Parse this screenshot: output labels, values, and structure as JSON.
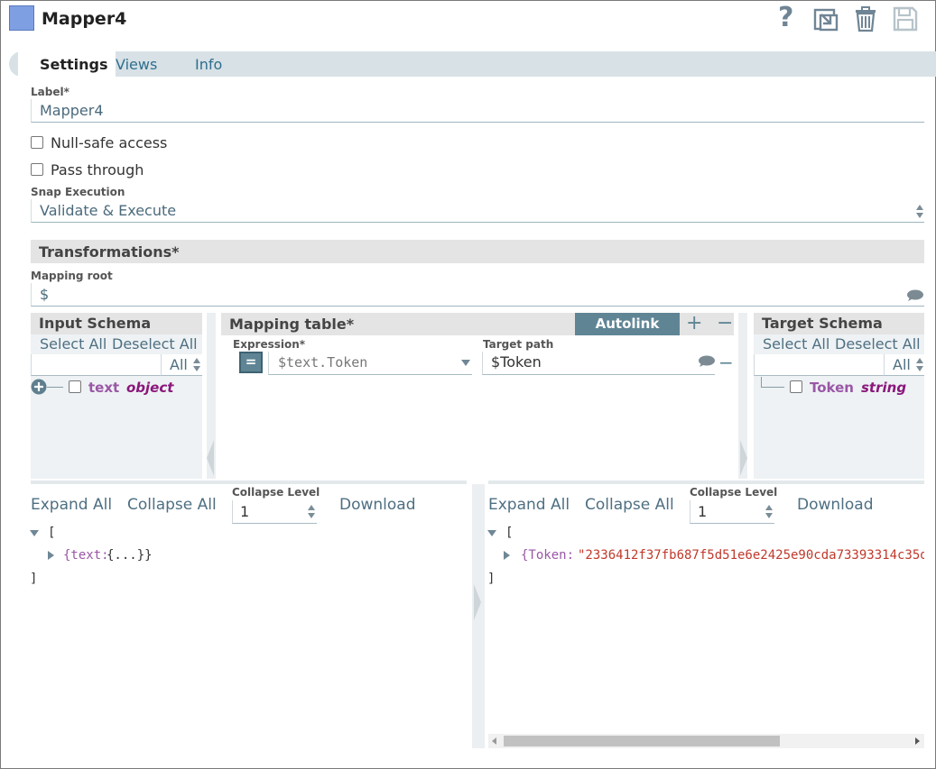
{
  "header": {
    "title": "Mapper4",
    "help_glyph": "?",
    "icons": [
      "help-icon",
      "export-icon",
      "trash-icon",
      "save-icon"
    ]
  },
  "tabs": [
    {
      "label": "Settings",
      "active": true
    },
    {
      "label": "Views",
      "active": false
    },
    {
      "label": "Info",
      "active": false
    }
  ],
  "settings": {
    "label_field": {
      "label": "Label*",
      "value": "Mapper4"
    },
    "null_safe": {
      "label": "Null-safe access",
      "checked": false
    },
    "pass_through": {
      "label": "Pass through",
      "checked": false
    },
    "snap_execution": {
      "label": "Snap Execution",
      "value": "Validate & Execute"
    }
  },
  "transformations": {
    "title": "Transformations*",
    "mapping_root": {
      "label": "Mapping root",
      "value": "$"
    }
  },
  "input_schema": {
    "title": "Input Schema",
    "select_all": "Select All",
    "deselect_all": "Deselect All",
    "filter_option": "All",
    "items": [
      {
        "name": "text",
        "type": "object"
      }
    ]
  },
  "mapping_table": {
    "title": "Mapping table*",
    "autolink": "Autolink",
    "add_glyph": "+",
    "remove_glyph": "−",
    "expression_label": "Expression*",
    "target_label": "Target path",
    "eq_glyph": "=",
    "rows": [
      {
        "expression": "$text.Token",
        "target": "$Token"
      }
    ]
  },
  "target_schema": {
    "title": "Target Schema",
    "select_all": "Select All",
    "deselect_all": "Deselect All",
    "filter_option": "All",
    "items": [
      {
        "name": "Token",
        "type": "string"
      }
    ]
  },
  "preview_left": {
    "expand_all": "Expand All",
    "collapse_all": "Collapse All",
    "collapse_level_label": "Collapse Level",
    "collapse_level": "1",
    "download": "Download",
    "open_bracket": "[",
    "close_bracket": "]",
    "row_key": "{text:",
    "row_value": "{...}}"
  },
  "preview_right": {
    "expand_all": "Expand All",
    "collapse_all": "Collapse All",
    "collapse_level_label": "Collapse Level",
    "collapse_level": "1",
    "download": "Download",
    "open_bracket": "[",
    "close_bracket": "]",
    "row_key": "{Token:",
    "row_value": "\"2336412f37fb687f5d51e6e2425e90cda73393314c35d",
    "scroll_fraction": 0.39
  },
  "colors": {
    "accent": "#5f8595",
    "schema_name": "#9a57a6",
    "schema_type": "#8a187c",
    "json_string": "#c0392b"
  }
}
